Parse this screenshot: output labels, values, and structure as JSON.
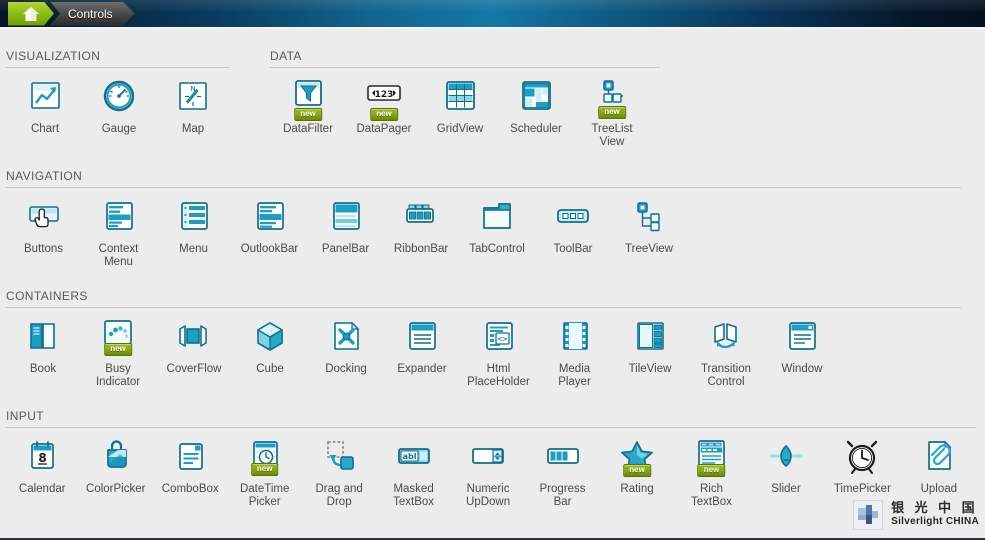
{
  "header": {
    "home_icon": "house-icon",
    "breadcrumb": "Controls",
    "gradient_left": "#051426",
    "gradient_mid": "#1577a6",
    "home_green": "#8cbb14"
  },
  "badge_label": "new",
  "sections": [
    {
      "key": "visualization",
      "title": "VISUALIZATION",
      "items": [
        {
          "label": "Chart",
          "icon": "chart-icon",
          "new": false
        },
        {
          "label": "Gauge",
          "icon": "gauge-icon",
          "new": false
        },
        {
          "label": "Map",
          "icon": "map-compass-icon",
          "new": false
        }
      ]
    },
    {
      "key": "data",
      "title": "DATA",
      "items": [
        {
          "label": "DataFilter",
          "icon": "datafilter-icon",
          "new": true
        },
        {
          "label": "DataPager",
          "icon": "datapager-icon",
          "new": true
        },
        {
          "label": "GridView",
          "icon": "gridview-icon",
          "new": false
        },
        {
          "label": "Scheduler",
          "icon": "scheduler-icon",
          "new": false
        },
        {
          "label": "TreeList\nView",
          "icon": "treelistview-icon",
          "new": true
        }
      ]
    },
    {
      "key": "navigation",
      "title": "NAVIGATION",
      "items": [
        {
          "label": "Buttons",
          "icon": "buttons-icon",
          "new": false
        },
        {
          "label": "Context\nMenu",
          "icon": "contextmenu-icon",
          "new": false
        },
        {
          "label": "Menu",
          "icon": "menu-icon",
          "new": false
        },
        {
          "label": "OutlookBar",
          "icon": "outlookbar-icon",
          "new": false
        },
        {
          "label": "PanelBar",
          "icon": "panelbar-icon",
          "new": false
        },
        {
          "label": "RibbonBar",
          "icon": "ribbonbar-icon",
          "new": false
        },
        {
          "label": "TabControl",
          "icon": "tabcontrol-icon",
          "new": false
        },
        {
          "label": "ToolBar",
          "icon": "toolbar-icon",
          "new": false
        },
        {
          "label": "TreeView",
          "icon": "treeview-icon",
          "new": false
        }
      ]
    },
    {
      "key": "containers",
      "title": "CONTAINERS",
      "items": [
        {
          "label": "Book",
          "icon": "book-icon",
          "new": false
        },
        {
          "label": "Busy\nIndicator",
          "icon": "busyindicator-icon",
          "new": true
        },
        {
          "label": "CoverFlow",
          "icon": "coverflow-icon",
          "new": false
        },
        {
          "label": "Cube",
          "icon": "cube-icon",
          "new": false
        },
        {
          "label": "Docking",
          "icon": "docking-icon",
          "new": false
        },
        {
          "label": "Expander",
          "icon": "expander-icon",
          "new": false
        },
        {
          "label": "Html\nPlaceHolder",
          "icon": "htmlplaceholder-icon",
          "new": false
        },
        {
          "label": "Media\nPlayer",
          "icon": "mediaplayer-icon",
          "new": false
        },
        {
          "label": "TileView",
          "icon": "tileview-icon",
          "new": false
        },
        {
          "label": "Transition\nControl",
          "icon": "transitioncontrol-icon",
          "new": false
        },
        {
          "label": "Window",
          "icon": "window-icon",
          "new": false
        }
      ]
    },
    {
      "key": "input",
      "title": "INPUT",
      "items": [
        {
          "label": "Calendar",
          "icon": "calendar-icon",
          "new": false
        },
        {
          "label": "ColorPicker",
          "icon": "colorpicker-icon",
          "new": false
        },
        {
          "label": "ComboBox",
          "icon": "combobox-icon",
          "new": false
        },
        {
          "label": "DateTime\nPicker",
          "icon": "datetimepicker-icon",
          "new": true
        },
        {
          "label": "Drag and\nDrop",
          "icon": "draganddrop-icon",
          "new": false
        },
        {
          "label": "Masked\nTextBox",
          "icon": "maskedtextbox-icon",
          "new": false
        },
        {
          "label": "Numeric\nUpDown",
          "icon": "numericupdown-icon",
          "new": false
        },
        {
          "label": "Progress\nBar",
          "icon": "progressbar-icon",
          "new": false
        },
        {
          "label": "Rating",
          "icon": "rating-icon",
          "new": true
        },
        {
          "label": "Rich\nTextBox",
          "icon": "richtextbox-icon",
          "new": true
        },
        {
          "label": "Slider",
          "icon": "slider-icon",
          "new": false
        },
        {
          "label": "TimePicker",
          "icon": "timepicker-icon",
          "new": false
        },
        {
          "label": "Upload",
          "icon": "upload-icon",
          "new": false
        }
      ]
    }
  ],
  "calendar_day": "8",
  "masked_text": "abl",
  "datapager_text": "123",
  "watermark": {
    "cn": "银 光 中 国",
    "en": "Silverlight CHINA",
    "mark": "silverlight-logo-icon"
  },
  "theme": {
    "teal": "#1a9ec4",
    "teal_dark": "#0f6f8d",
    "panel_bg": "#ececec",
    "rule": "#c9c9c9",
    "label": "#4a4a4a",
    "green": "#8cbb14"
  }
}
